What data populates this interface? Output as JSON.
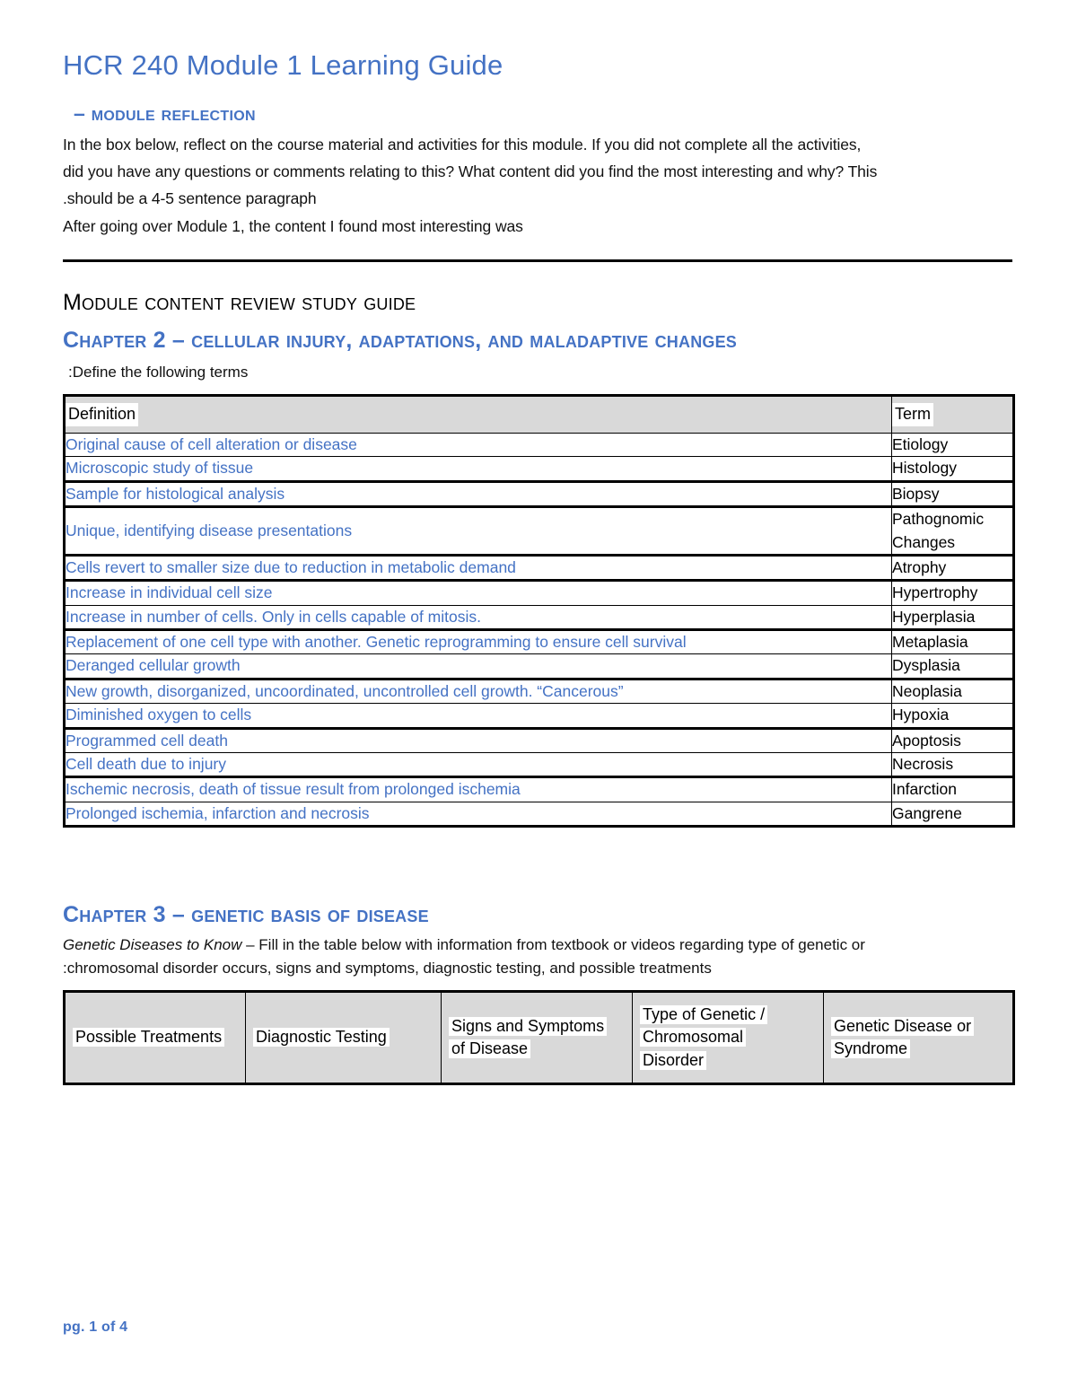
{
  "document": {
    "title": "HCR 240 Module 1 Learning Guide",
    "accent_color": "#4472C4",
    "header_fill_color": "#D9D9D9"
  },
  "reflection": {
    "heading": "– Module Reflection",
    "prompt_line_1": "In the box below, reflect on the course material and activities for this module. If you did not complete all the activities,",
    "prompt_line_2": "did you have any questions or comments relating to this? What content did you find the most interesting and why? This",
    "prompt_line_3": " .should be a 4-5 sentence paragraph",
    "response_line": "After going over Module 1, the content I found most interesting was"
  },
  "study_guide": {
    "heading": "Module Content Review Study Guide",
    "chapter2_heading": "Chapter 2 – Cellular Injury, Adaptations, and Maladaptive Changes",
    "chapter2_instruction": ":Define the following terms",
    "table": {
      "columns": [
        "Definition",
        "Term"
      ],
      "rows": [
        {
          "definition": "Original cause of cell alteration or disease",
          "term": "Etiology"
        },
        {
          "definition": "Microscopic study of tissue",
          "term": "Histology"
        },
        {
          "definition": "Sample for histological analysis",
          "term": "Biopsy"
        },
        {
          "definition": "Unique, identifying disease presentations",
          "term": "Pathognomic Changes"
        },
        {
          "definition": "Cells revert to smaller size due to reduction in metabolic demand",
          "term": "Atrophy"
        },
        {
          "definition": "Increase in individual cell size",
          "term": "Hypertrophy"
        },
        {
          "definition": "Increase in number of cells. Only in cells capable of mitosis.",
          "term": "Hyperplasia"
        },
        {
          "definition": "Replacement of one cell type with another. Genetic reprogramming to ensure cell survival",
          "term": "Metaplasia"
        },
        {
          "definition": "Deranged cellular growth",
          "term": "Dysplasia"
        },
        {
          "definition": "New growth, disorganized, uncoordinated, uncontrolled cell growth. “Cancerous”",
          "term": "Neoplasia"
        },
        {
          "definition": "Diminished oxygen to cells",
          "term": "Hypoxia"
        },
        {
          "definition": "Programmed cell death",
          "term": "Apoptosis"
        },
        {
          "definition": "Cell death due to injury",
          "term": "Necrosis"
        },
        {
          "definition": "Ischemic necrosis, death of tissue result from prolonged ischemia",
          "term": "Infarction"
        },
        {
          "definition": "Prolonged ischemia, infarction and necrosis",
          "term": "Gangrene"
        }
      ]
    }
  },
  "chapter3": {
    "heading": "Chapter 3 – Genetic Basis of Disease",
    "instruction_italic": "Genetic Diseases to Know",
    "instruction_line_1_rest": " – Fill in the table below with information from textbook or videos regarding type of genetic or",
    "instruction_line_2": " :chromosomal disorder occurs, signs and symptoms, diagnostic testing, and possible treatments",
    "table": {
      "columns": [
        "Possible Treatments",
        "Diagnostic Testing",
        "Signs and Symptoms|of Disease",
        "Type of Genetic /|Chromosomal|Disorder",
        "Genetic Disease or|Syndrome"
      ],
      "col_0": "Possible Treatments",
      "col_1": "Diagnostic Testing",
      "col_2_line_1": "Signs and Symptoms",
      "col_2_line_2": "of Disease",
      "col_3_line_1": "Type of Genetic /",
      "col_3_line_2": "Chromosomal",
      "col_3_line_3": "Disorder",
      "col_4_line_1": "Genetic Disease or",
      "col_4_line_2": "Syndrome"
    }
  },
  "footer": {
    "page_label": "pg. 1 of 4"
  }
}
